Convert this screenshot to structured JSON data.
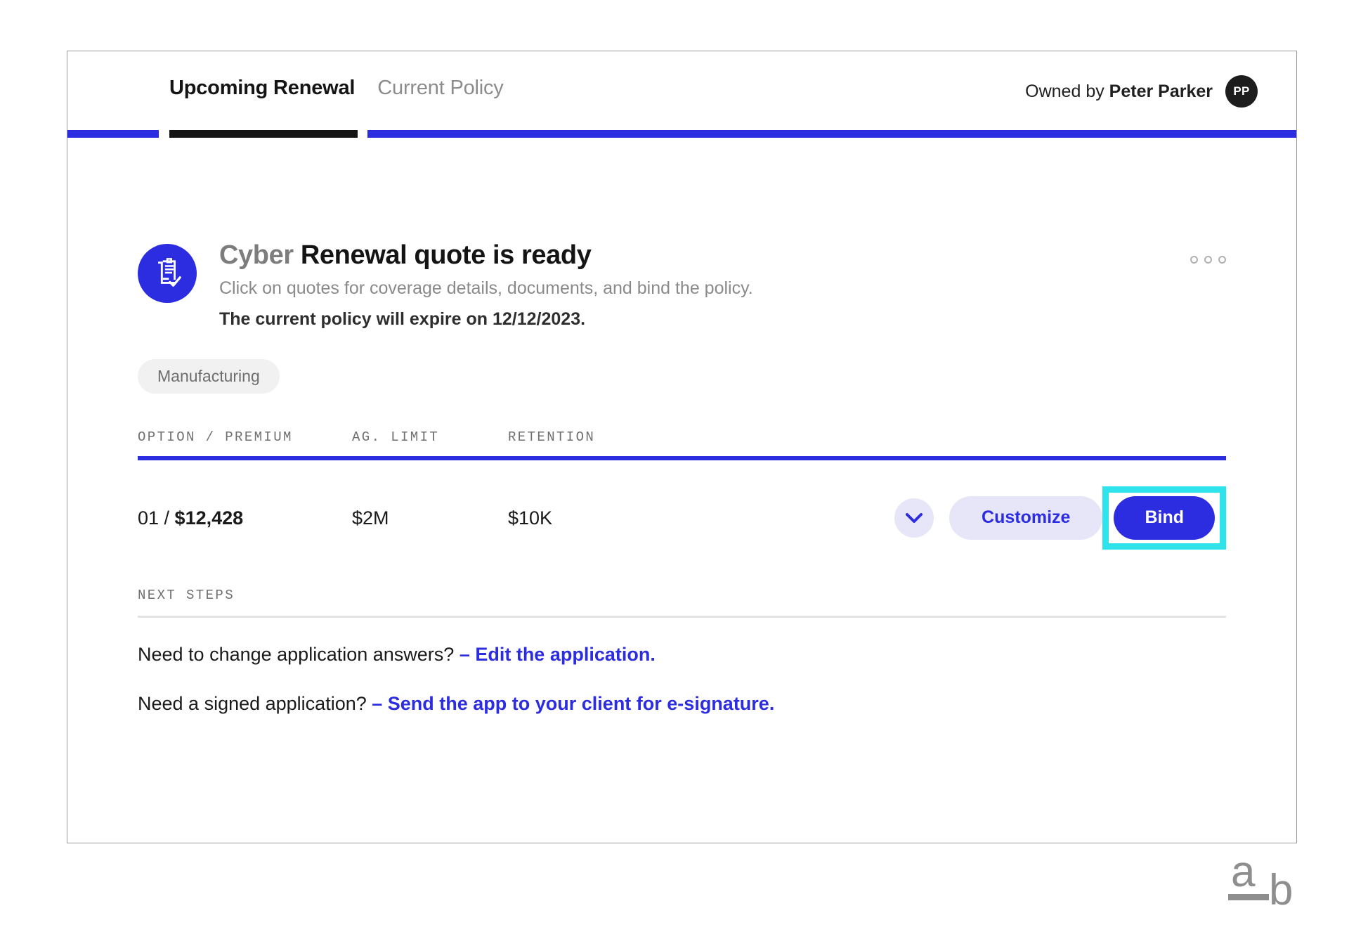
{
  "theme": {
    "accent_blue": "#2c2ce0",
    "highlight_cyan": "#2fe3ec",
    "active_tab_underline": "#141414",
    "muted_gray": "#8a8a8a",
    "pill_bg": "#e6e6f8",
    "tag_bg": "#f1f1f1"
  },
  "header": {
    "tabs": [
      {
        "label": "Upcoming Renewal",
        "active": true
      },
      {
        "label": "Current Policy",
        "active": false
      }
    ],
    "owner": {
      "prefix": "Owned by ",
      "name": "Peter Parker",
      "avatar_initials": "PP"
    }
  },
  "quote": {
    "icon": "clipboard-check-icon",
    "title_prefix": "Cyber ",
    "title": "Renewal quote is ready",
    "subtitle": "Click on quotes for coverage details, documents, and bind the policy.",
    "expiry_text": "The current policy will expire on 12/12/2023.",
    "tag": "Manufacturing",
    "overflow_menu": "more-options-icon"
  },
  "table": {
    "columns": [
      "OPTION / PREMIUM",
      "AG. LIMIT",
      "RETENTION"
    ],
    "rows": [
      {
        "option_label": "01 / ",
        "premium": "$12,428",
        "ag_limit": "$2M",
        "retention": "$10K",
        "expand_icon": "chevron-down-icon",
        "customize_label": "Customize",
        "bind_label": "Bind",
        "bind_highlighted": true
      }
    ]
  },
  "next_steps": {
    "label": "NEXT STEPS",
    "items": [
      {
        "question": "Need to change application answers? ",
        "link": "– Edit the application."
      },
      {
        "question": "Need a signed application? ",
        "link": "– Send the app to your client for e-signature."
      }
    ]
  },
  "brand": {
    "glyph_top": "a",
    "glyph_bottom": "b"
  }
}
